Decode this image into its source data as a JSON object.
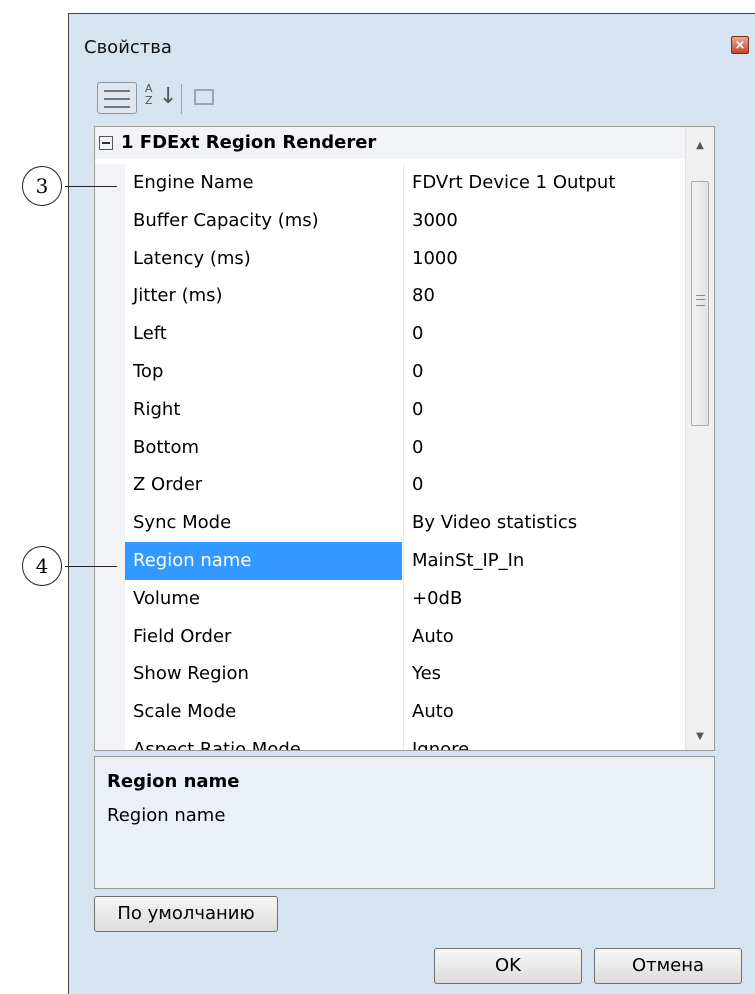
{
  "window": {
    "title": "Свойства",
    "close_glyph": "×"
  },
  "toolbar": {
    "alpha_sort_glyph": "A\nZ",
    "alpha_arrow": "↓"
  },
  "grid": {
    "category": {
      "toggle": "−",
      "label": "1 FDExt Region Renderer"
    },
    "rows": [
      {
        "name": "Engine Name",
        "value": "FDVrt Device 1 Output"
      },
      {
        "name": "Buffer Capacity (ms)",
        "value": "3000"
      },
      {
        "name": "Latency (ms)",
        "value": "1000"
      },
      {
        "name": "Jitter (ms)",
        "value": "80"
      },
      {
        "name": "Left",
        "value": "0"
      },
      {
        "name": "Top",
        "value": "0"
      },
      {
        "name": "Right",
        "value": "0"
      },
      {
        "name": "Bottom",
        "value": "0"
      },
      {
        "name": "Z Order",
        "value": "0"
      },
      {
        "name": "Sync Mode",
        "value": "By Video statistics"
      },
      {
        "name": "Region name",
        "value": "MainSt_IP_In",
        "selected": true
      },
      {
        "name": "Volume",
        "value": "+0dB"
      },
      {
        "name": "Field Order",
        "value": "Auto"
      },
      {
        "name": "Show Region",
        "value": "Yes"
      },
      {
        "name": "Scale Mode",
        "value": "Auto"
      },
      {
        "name": "Aspect Ratio Mode",
        "value": "Ignore"
      }
    ],
    "scroll_up": "▲",
    "scroll_down": "▼"
  },
  "description": {
    "title": "Region name",
    "text": "Region name"
  },
  "buttons": {
    "default": "По умолчанию",
    "ok": "OK",
    "cancel": "Отмена"
  },
  "callouts": [
    {
      "label": "3"
    },
    {
      "label": "4"
    }
  ]
}
